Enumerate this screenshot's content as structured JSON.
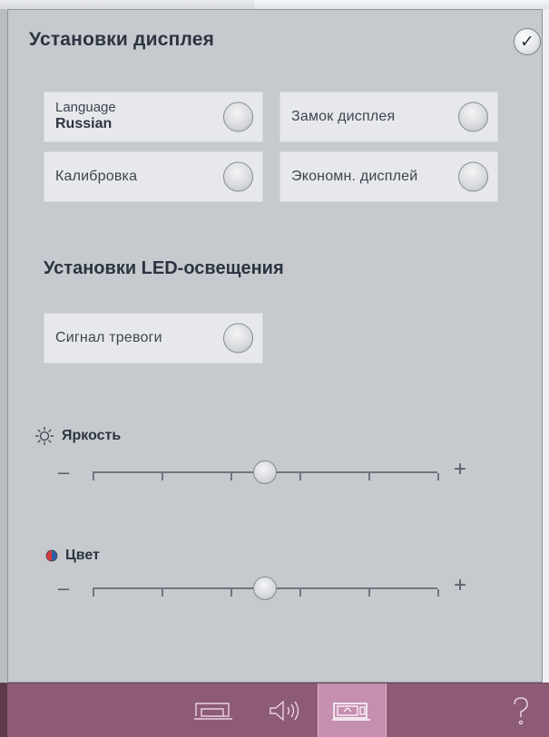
{
  "header": {
    "title": "Установки дисплея"
  },
  "display_settings": [
    {
      "id": "language",
      "label": "Language",
      "value": "Russian",
      "checked": false
    },
    {
      "id": "lock",
      "label": "Замок дисплея",
      "checked": false
    },
    {
      "id": "calibration",
      "label": "Калибровка",
      "checked": false
    },
    {
      "id": "economy",
      "label": "Экономн. дисплей",
      "checked": false
    }
  ],
  "led": {
    "title": "Установки LED-освещения",
    "alarm": {
      "label": "Сигнал тревоги",
      "checked": false
    },
    "brightness": {
      "label": "Яркость",
      "value_fraction": 0.5,
      "min_symbol": "–",
      "max_symbol": "+"
    },
    "color": {
      "label": "Цвет",
      "value_fraction": 0.5,
      "min_symbol": "–",
      "max_symbol": "+"
    }
  },
  "toolbar": {
    "buttons": [
      {
        "id": "machine",
        "icon": "sewing-machine-icon",
        "active": false
      },
      {
        "id": "sound",
        "icon": "speaker-icon",
        "active": false
      },
      {
        "id": "display",
        "icon": "machine-display-icon",
        "active": true
      },
      {
        "id": "help",
        "icon": "help-icon",
        "label": "?",
        "active": false
      }
    ]
  },
  "colors": {
    "panel_bg": "#c6c9ce",
    "tile_bg": "#e6e8eb",
    "text_dark": "#2b3440",
    "toolbar_bg": "#8d5b75",
    "toolbar_active": "#c58fb0",
    "color_icon_left": "#d63a3a",
    "color_icon_right": "#2f5ea8"
  }
}
